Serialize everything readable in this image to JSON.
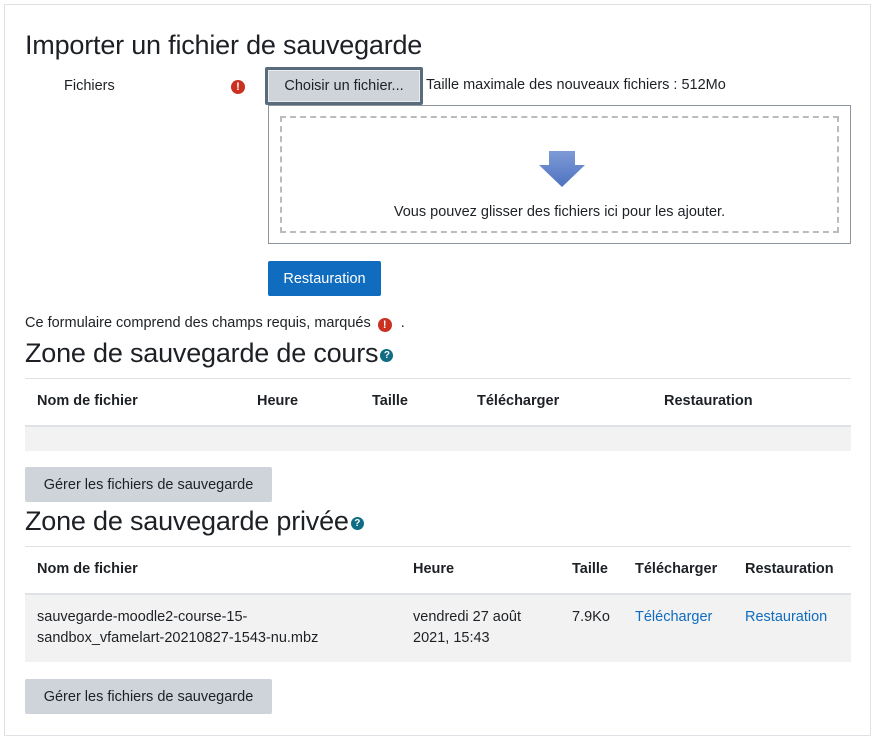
{
  "import_section": {
    "title": "Importer un fichier de sauvegarde",
    "files_label": "Fichiers",
    "required_icon": "!",
    "choose_button": "Choisir un fichier...",
    "max_size": "Taille maximale des nouveaux fichiers : 512Mo",
    "dropzone_text": "Vous pouvez glisser des fichiers ici pour les ajouter.",
    "dropzone_arrow_icon": "arrow-down-icon",
    "restore_button": "Restauration",
    "required_note_prefix": "Ce formulaire comprend des champs requis, marqués",
    "required_note_suffix": "."
  },
  "course_zone": {
    "title": "Zone de sauvegarde de cours",
    "help_icon": "?",
    "columns": [
      "Nom de fichier",
      "Heure",
      "Taille",
      "Télécharger",
      "Restauration"
    ],
    "rows": [],
    "manage_button": "Gérer les fichiers de sauvegarde"
  },
  "private_zone": {
    "title": "Zone de sauvegarde privée",
    "help_icon": "?",
    "columns": [
      "Nom de fichier",
      "Heure",
      "Taille",
      "Télécharger",
      "Restauration"
    ],
    "rows": [
      {
        "filename_line1": "sauvegarde-moodle2-course-15-",
        "filename_line2": "sandbox_vfamelart-20210827-1543-nu.mbz",
        "time_line1": "vendredi 27 août",
        "time_line2": "2021, 15:43",
        "size": "7.9Ko",
        "download": "Télécharger",
        "restore": "Restauration"
      }
    ],
    "manage_button": "Gérer les fichiers de sauvegarde"
  },
  "colors": {
    "primary": "#0f6cbf",
    "danger": "#ca3120",
    "info": "#0f6e84",
    "row_bg": "#f2f2f2"
  }
}
